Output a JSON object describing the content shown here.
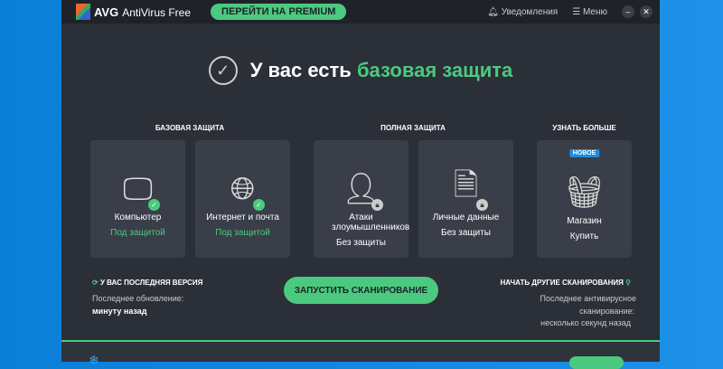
{
  "titlebar": {
    "brand": "AVG",
    "product": "AntiVirus Free",
    "premium_button": "ПЕРЕЙТИ НА PREMIUM",
    "notifications": "Уведомления",
    "menu": "Меню"
  },
  "hero": {
    "prefix": "У вас есть",
    "highlight": "базовая защита"
  },
  "sections": {
    "basic": "БАЗОВАЯ ЗАЩИТА",
    "full": "ПОЛНАЯ ЗАЩИТА",
    "more": "УЗНАТЬ БОЛЬШЕ"
  },
  "cards": [
    {
      "title": "Компьютер",
      "status": "Под защитой"
    },
    {
      "title": "Интернет и почта",
      "status": "Под защитой"
    },
    {
      "title": "Атаки злоумышленников",
      "status": "Без защиты"
    },
    {
      "title": "Личные данные",
      "status": "Без защиты"
    },
    {
      "badge": "НОВОЕ",
      "title": "Магазин",
      "status": "Купить"
    }
  ],
  "update": {
    "title": "У ВАС ПОСЛЕДНЯЯ ВЕРСИЯ",
    "label": "Последнее обновление:",
    "value": "минуту назад"
  },
  "scan_button": "ЗАПУСТИТЬ СКАНИРОВАНИЕ",
  "other_scans": {
    "title": "НАЧАТЬ ДРУГИЕ СКАНИРОВАНИЯ",
    "label1": "Последнее антивирусное",
    "label2": "сканирование:",
    "value": "несколько секунд назад"
  },
  "colors": {
    "accent": "#4bca7f",
    "bg": "#2b2f38",
    "card": "#3a3e48"
  }
}
